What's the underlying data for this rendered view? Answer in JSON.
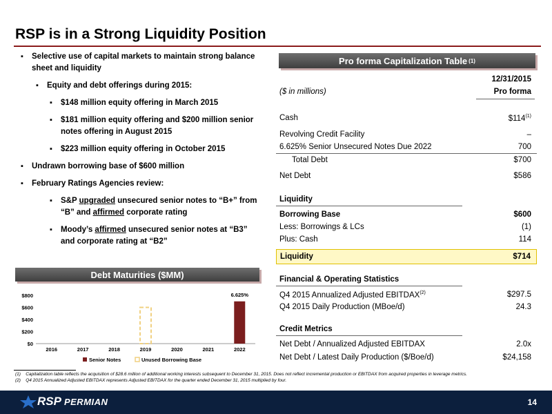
{
  "title": "RSP is in a Strong Liquidity Position",
  "bullets": [
    {
      "level": 1,
      "text": "Selective use of capital markets to maintain strong balance sheet and liquidity"
    },
    {
      "level": 2,
      "text": "Equity and debt offerings during 2015:"
    },
    {
      "level": 3,
      "text": "$148 million equity offering in March 2015"
    },
    {
      "level": 3,
      "text": "$181 million equity offering and $200 million senior notes offering in August 2015"
    },
    {
      "level": 3,
      "text": "$223 million equity offering in October 2015"
    },
    {
      "level": 1,
      "text": "Undrawn borrowing base of $600 million"
    },
    {
      "level": 1,
      "text": "February Ratings Agencies review:"
    }
  ],
  "sp_bullet": {
    "pre": "S&P ",
    "u1": "upgraded",
    "mid": " unsecured senior notes to “B+” from “B” and ",
    "u2": "affirmed",
    "post": " corporate rating"
  },
  "moody_bullet": {
    "pre": "Moody’s ",
    "u1": "affirmed",
    "post": " unsecured senior notes at “B3” and corporate rating at “B2”"
  },
  "cap_banner": "Pro forma Capitalization Table",
  "cap_banner_note": "(1)",
  "cap_header": {
    "units": "($ in millions)",
    "date": "12/31/2015",
    "col": "Pro forma"
  },
  "cap_rows": {
    "cash": {
      "label": "Cash",
      "value": "$114",
      "note": "(1)"
    },
    "rcf": {
      "label": "Revolving Credit Facility",
      "value": "–"
    },
    "notes": {
      "label": "6.625% Senior Unsecured Notes Due 2022",
      "value": "700"
    },
    "total_debt": {
      "label": "Total Debt",
      "value": "$700"
    },
    "net_debt": {
      "label": "Net Debt",
      "value": "$586"
    },
    "liquidity_hdr": {
      "label": "Liquidity"
    },
    "borrowing_base": {
      "label": "Borrowing Base",
      "value": "$600"
    },
    "less_borrow": {
      "label": "Less: Borrowings & LCs",
      "value": "(1)"
    },
    "plus_cash": {
      "label": "Plus: Cash",
      "value": "114"
    },
    "liquidity": {
      "label": "Liquidity",
      "value": "$714"
    },
    "fin_hdr": {
      "label": "Financial & Operating Statistics"
    },
    "ebitdax": {
      "label": "Q4 2015 Annualized Adjusted EBITDAX",
      "note": "(2)",
      "value": "$297.5"
    },
    "production": {
      "label": "Q4 2015 Daily Production (MBoe/d)",
      "value": "24.3"
    },
    "credit_hdr": {
      "label": "Credit Metrics"
    },
    "nd_ebitdax": {
      "label": "Net Debt / Annualized Adjusted EBITDAX",
      "value": "2.0x"
    },
    "nd_prod": {
      "label": "Net Debt / Latest Daily Production ($/Boe/d)",
      "value": "$24,158"
    }
  },
  "debt_banner": "Debt Maturities ($MM)",
  "chart_data": {
    "type": "bar",
    "categories": [
      "2016",
      "2017",
      "2018",
      "2019",
      "2020",
      "2021",
      "2022"
    ],
    "series": [
      {
        "name": "Senior Notes",
        "values": [
          0,
          0,
          0,
          0,
          0,
          0,
          700
        ],
        "color": "#7b1e1e"
      },
      {
        "name": "Unused Borrowing Base",
        "values": [
          0,
          0,
          0,
          600,
          0,
          0,
          0
        ],
        "color": "#f0d080"
      }
    ],
    "yticks": [
      "$0",
      "$200",
      "$400",
      "$600",
      "$800"
    ],
    "ylim": [
      0,
      800
    ],
    "annotations": [
      {
        "category": "2022",
        "text": "6.625%"
      }
    ],
    "legend": "bottom"
  },
  "footnotes": [
    {
      "num": "(1)",
      "text": "Capitalization table reflects the acquisition of $28.6 million of additional working interests subsequent to December 31, 2015. Does not reflect incremental production or EBITDAX from acquired properties in leverage metrics."
    },
    {
      "num": "(2)",
      "text": "Q4 2015 Annualized Adjusted EBITDAX represents Adjusted EBITDAX for the quarter ended December 31, 2015 multiplied by four."
    }
  ],
  "logo": {
    "main": "RSP",
    "sub": "PERMIAN"
  },
  "page_number": "14"
}
